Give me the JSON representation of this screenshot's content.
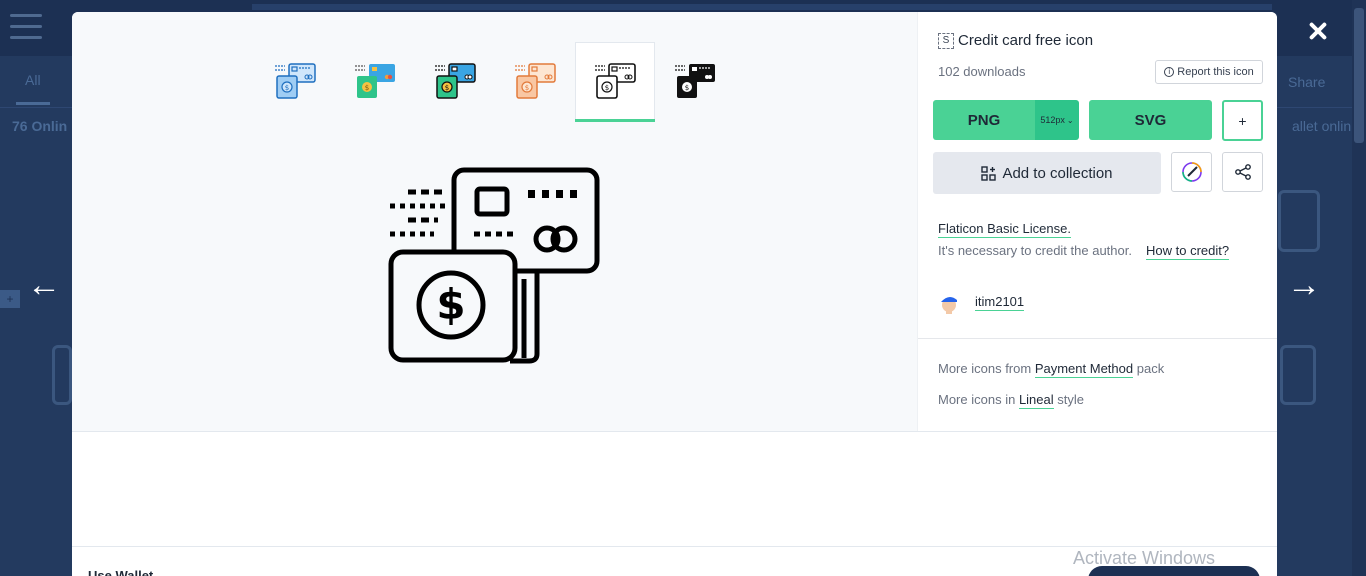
{
  "background": {
    "tab_all": "All",
    "count_text": "76 Onlin",
    "right_text": "allet onlin",
    "share_label": "Share",
    "plus_label": "+"
  },
  "navigation": {
    "prev_icon": "arrow-left-icon",
    "next_icon": "arrow-right-icon",
    "prev_glyph": "←",
    "next_glyph": "→"
  },
  "icon": {
    "title": "Credit card free icon",
    "title_badge": "S",
    "downloads": "102 downloads",
    "report_label": "Report this icon"
  },
  "variants": [
    {
      "style": "lineal-color-blue",
      "active": false
    },
    {
      "style": "flat",
      "active": false
    },
    {
      "style": "lineal-color",
      "active": false
    },
    {
      "style": "lineal-color-orange",
      "active": false
    },
    {
      "style": "lineal",
      "active": true
    },
    {
      "style": "glyph",
      "active": false
    }
  ],
  "download": {
    "png_label": "PNG",
    "size_label": "512px",
    "svg_label": "SVG",
    "plus_label": "+",
    "collection_label": "Add to collection"
  },
  "license": {
    "link": "Flaticon Basic License.",
    "credit_text": "It's necessary to credit the author.",
    "credit_link": "How to credit?"
  },
  "author": {
    "name": "itim2101"
  },
  "more": {
    "pack_prefix": "More icons from",
    "pack_link": "Payment Method",
    "pack_suffix": "pack",
    "style_prefix": "More icons in",
    "style_link": "Lineal",
    "style_suffix": "style"
  },
  "related": {
    "title": "Use Wallet"
  },
  "overlay": {
    "activate": "Activate Windows"
  },
  "colors": {
    "accent": "#4ad295",
    "accent_dark": "#2ec48a",
    "backdrop": "#1c3053"
  }
}
